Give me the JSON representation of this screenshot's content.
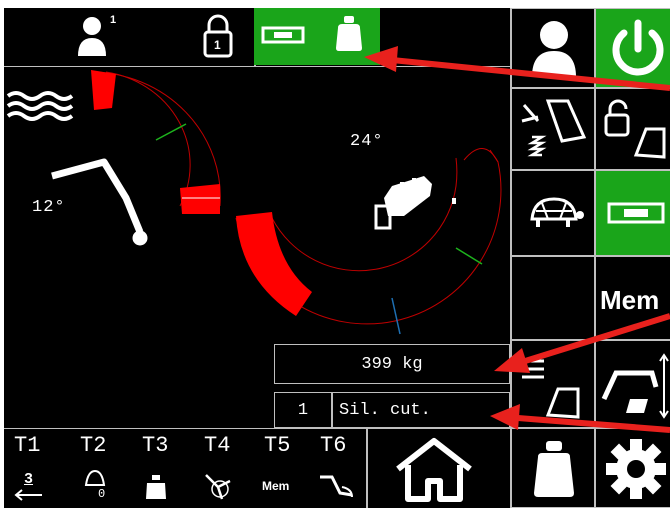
{
  "top_bar": {
    "user_badge": "1",
    "lock_badge": "1"
  },
  "gauges": {
    "boom_angle": "12°",
    "tilt_angle": "24°"
  },
  "readout": {
    "load": "399 kg",
    "counter": "1",
    "mode": "Sil. cut."
  },
  "tool_tabs": [
    "T1",
    "T2",
    "T3",
    "T4",
    "T5",
    "T6"
  ],
  "tool_tab_sub": {
    "t1_number": "3",
    "t2_number": "0",
    "t5_label": "Mem"
  },
  "side_panel": {
    "mem_label": "Mem"
  },
  "colors": {
    "active_green": "#1aa51a",
    "gauge_red": "#ff0000",
    "annotation_arrow": "#e8211d"
  }
}
